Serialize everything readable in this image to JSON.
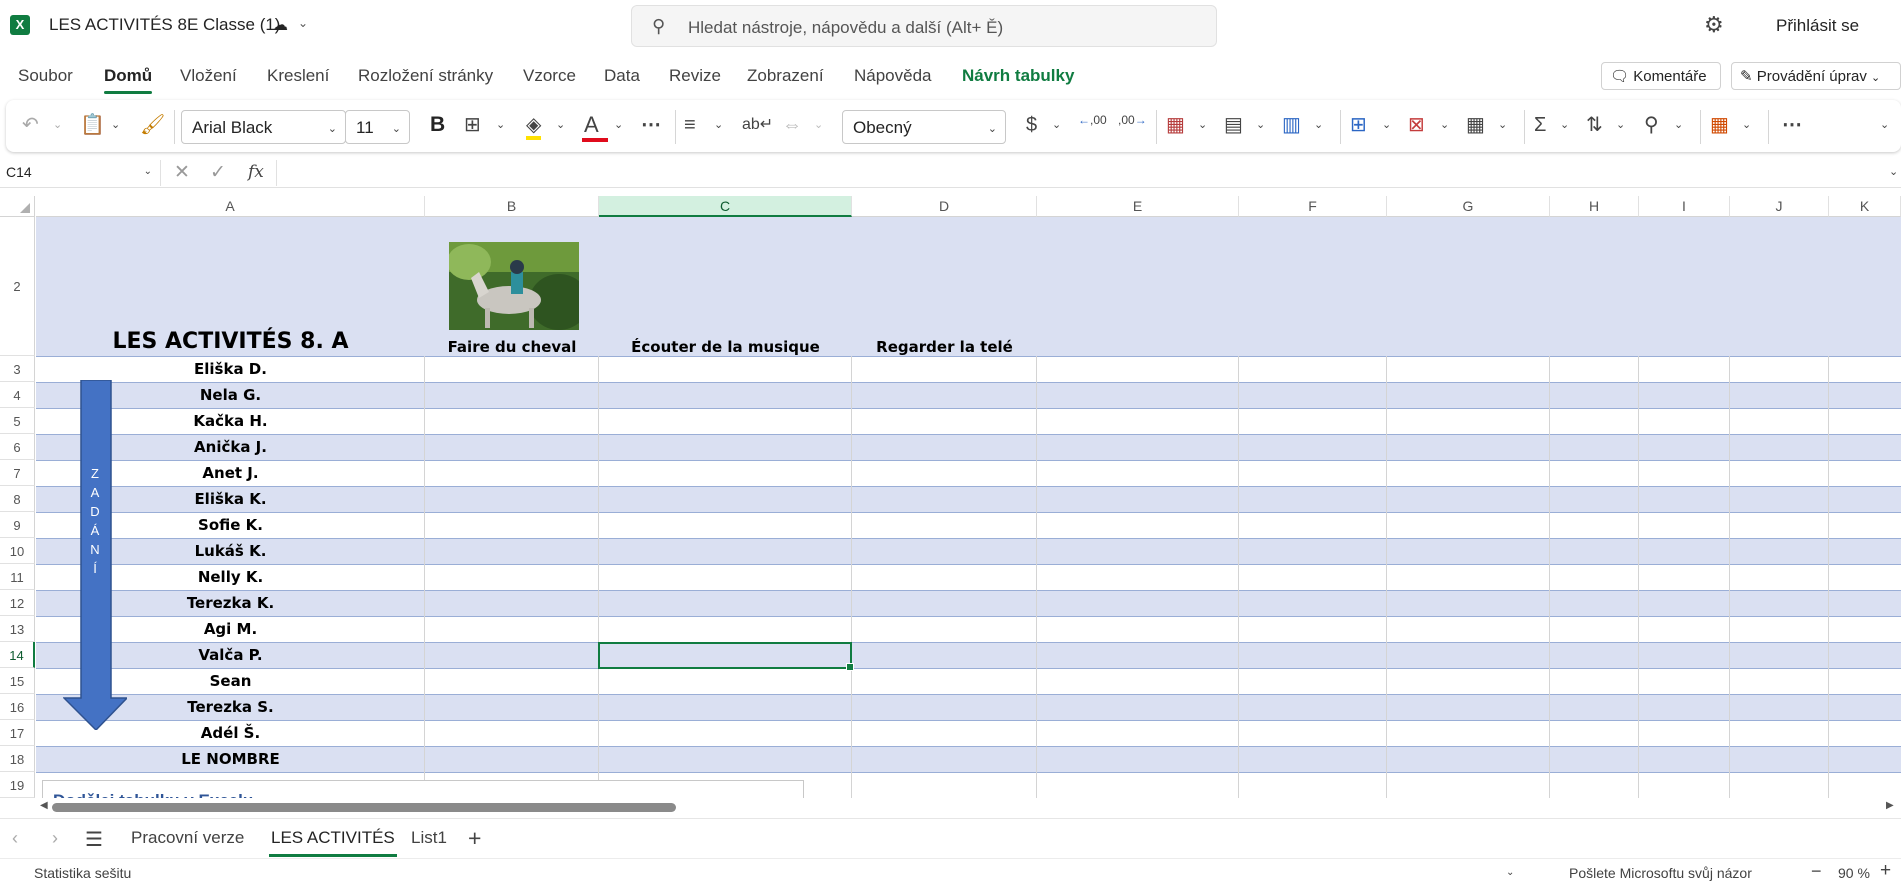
{
  "app": {
    "logo_letter": "X",
    "doc_title": "LES ACTIVITÉS 8E Classe (1)",
    "search_placeholder": "Hledat nástroje, nápovědu a další (Alt+ Ě)",
    "sign_in": "Přihlásit se"
  },
  "menu": {
    "tabs": [
      {
        "label": "Soubor"
      },
      {
        "label": "Domů"
      },
      {
        "label": "Vložení"
      },
      {
        "label": "Kreslení"
      },
      {
        "label": "Rozložení stránky"
      },
      {
        "label": "Vzorce"
      },
      {
        "label": "Data"
      },
      {
        "label": "Revize"
      },
      {
        "label": "Zobrazení"
      },
      {
        "label": "Nápověda"
      },
      {
        "label": "Návrh tabulky"
      }
    ],
    "comments_label": "Komentáře",
    "editing_label": "Provádění úprav"
  },
  "ribbon": {
    "font_name": "Arial Black",
    "font_size": "11",
    "bold_label": "B",
    "font_color_label": "A",
    "number_format": "Obecný",
    "currency_label": "$",
    "dec_inc": ",00",
    "dec_dec": ",00"
  },
  "formula_bar": {
    "cell_ref": "C14",
    "fx_label": "fx"
  },
  "grid": {
    "columns": [
      "A",
      "B",
      "C",
      "D",
      "E",
      "F",
      "G",
      "H",
      "I",
      "J",
      "K"
    ],
    "selected_column": "C",
    "rows": [
      "2",
      "3",
      "4",
      "5",
      "6",
      "7",
      "8",
      "9",
      "10",
      "11",
      "12",
      "13",
      "14",
      "15",
      "16",
      "17",
      "18",
      "19"
    ],
    "selected_row": "14",
    "title": "LES ACTIVITÉS 8. A",
    "headers": [
      "Faire du cheval",
      "Écouter de la musique",
      "Regarder la telé"
    ],
    "names": [
      "Eliška D.",
      "Nela G.",
      "Kačka H.",
      "Anička J.",
      "Anet J.",
      "Eliška K.",
      "Sofie K.",
      "Lukáš K.",
      "Nelly K.",
      "Terezka K.",
      "Agi M.",
      "Valča P.",
      "Sean",
      "Terezka S.",
      "Adél Š."
    ],
    "total_label": "LE NOMBRE",
    "arrow_letters": [
      "Z",
      "A",
      "D",
      "Á",
      "N",
      "Í"
    ],
    "note_text": "Dodělej tabulku v Excelu",
    "band_color": "#dae0f2"
  },
  "sheets": {
    "tabs": [
      {
        "label": "Pracovní verze"
      },
      {
        "label": "LES ACTIVITÉS"
      },
      {
        "label": "List1"
      }
    ],
    "active": "LES ACTIVITÉS"
  },
  "status": {
    "workbook_stats": "Statistika sešitu",
    "feedback": "Pošlete Microsoftu svůj názor",
    "zoom": "90 %"
  },
  "colors": {
    "accent": "#107c41",
    "arrow_fill": "#4472c4"
  }
}
